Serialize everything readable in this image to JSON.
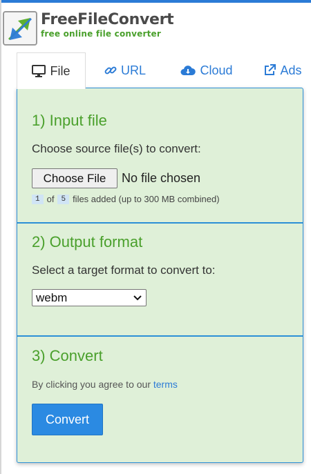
{
  "brand": {
    "title": "FreeFileConvert",
    "subtitle": "free online file converter",
    "colors": {
      "accent_blue": "#2b7bd6",
      "accent_green": "#4aa02c",
      "panel_bg": "#dff0d8"
    }
  },
  "tabs": [
    {
      "label": "File",
      "icon": "monitor-icon",
      "active": true
    },
    {
      "label": "URL",
      "icon": "link-icon",
      "active": false
    },
    {
      "label": "Cloud",
      "icon": "cloud-download-icon",
      "active": false
    },
    {
      "label": "Ads",
      "icon": "external-link-icon",
      "active": false
    }
  ],
  "input_section": {
    "title": "1) Input file",
    "prompt": "Choose source file(s) to convert:",
    "choose_button": "Choose File",
    "file_status": "No file chosen",
    "files_added": "1",
    "files_of": "of",
    "files_max": "5",
    "files_note": "files added (up to 300 MB combined)"
  },
  "output_section": {
    "title": "2) Output format",
    "prompt": "Select a target format to convert to:",
    "selected_format": "webm"
  },
  "convert_section": {
    "title": "3) Convert",
    "agree_text": "By clicking you agree to our",
    "terms_link": "terms",
    "convert_button": "Convert"
  }
}
